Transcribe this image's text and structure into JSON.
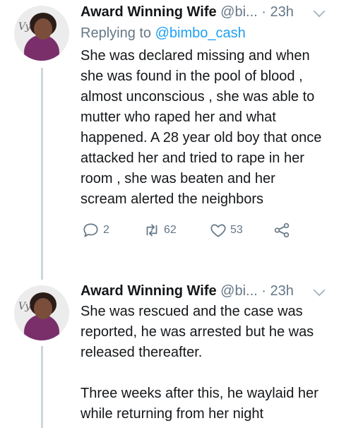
{
  "tweets": [
    {
      "name": "Award Winning Wife",
      "handle": "@bi...",
      "separator": "·",
      "time": "23h",
      "replying_prefix": "Replying to",
      "replying_to": "@bimbo_cash",
      "text": "She was declared missing and when she was found in the pool of blood , almost unconscious , she was able to mutter who raped her and what happened. A 28 year old boy that once attacked her and tried to rape in her room , she was beaten and her scream alerted the neighbors",
      "actions": {
        "replies": "2",
        "retweets": "62",
        "likes": "53"
      }
    },
    {
      "name": "Award Winning Wife",
      "handle": "@bi...",
      "separator": "·",
      "time": "23h",
      "para1": "She was rescued and the case was reported, he was arrested but he was released thereafter.",
      "para2": "Three weeks after this, he waylaid her while returning from her night"
    }
  ]
}
